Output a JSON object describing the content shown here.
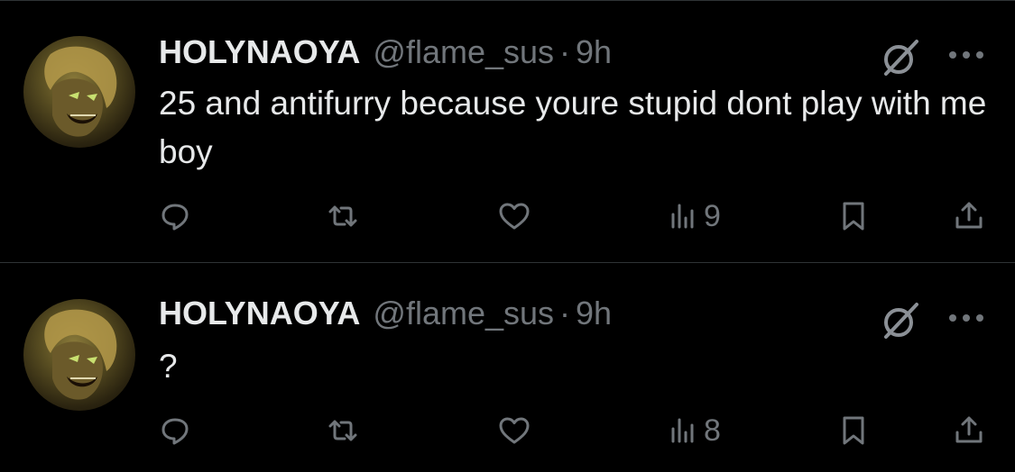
{
  "tweets": [
    {
      "name": "HOLYNAOYA",
      "handle": "@flame_sus",
      "separator": "·",
      "time": "9h",
      "text": "25 and antifurry because youre stupid dont play with me boy",
      "views": "9"
    },
    {
      "name": "HOLYNAOYA",
      "handle": "@flame_sus",
      "separator": "·",
      "time": "9h",
      "text": "?",
      "views": "8"
    }
  ],
  "colors": {
    "background": "#000000",
    "text": "#e7e9ea",
    "muted": "#71767b",
    "divider": "#2f3336"
  },
  "icons": [
    "avatar",
    "grok-icon",
    "more-icon",
    "reply-icon",
    "retweet-icon",
    "like-icon",
    "views-icon",
    "bookmark-icon",
    "share-icon"
  ]
}
